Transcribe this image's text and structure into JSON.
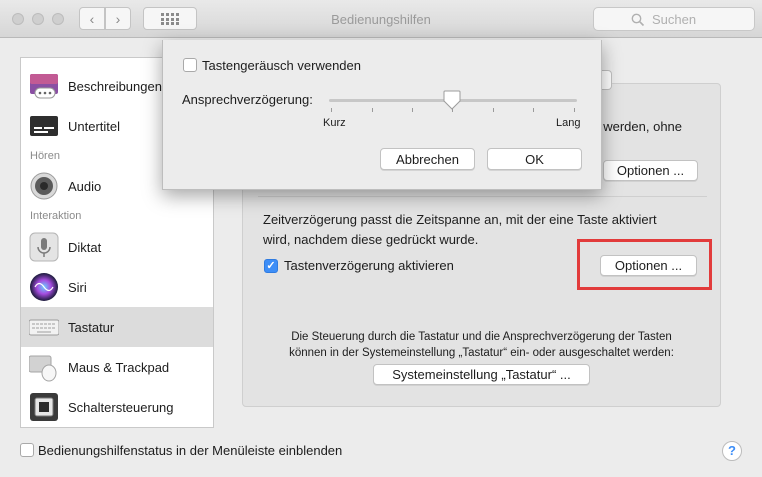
{
  "window": {
    "title": "Bedienungshilfen",
    "back_glyph": "‹",
    "forward_glyph": "›",
    "grid_glyph": "⋮⋮⋮",
    "search_placeholder": "Suchen"
  },
  "sidebar": {
    "items": [
      {
        "label": "Beschreibungen",
        "icon": "descriptions-icon"
      },
      {
        "label": "Untertitel",
        "icon": "captions-icon"
      },
      {
        "label": "Audio",
        "icon": "speaker-icon"
      },
      {
        "label": "Diktat",
        "icon": "microphone-icon"
      },
      {
        "label": "Siri",
        "icon": "siri-icon"
      },
      {
        "label": "Tastatur",
        "icon": "keyboard-icon"
      },
      {
        "label": "Maus & Trackpad",
        "icon": "mouse-trackpad-icon"
      },
      {
        "label": "Schaltersteuerung",
        "icon": "switch-control-icon"
      }
    ],
    "groups": {
      "hearing": "Hören",
      "interaction": "Interaktion"
    },
    "selected": "Tastatur"
  },
  "main": {
    "partial_text": "t werden, ohne",
    "options_top_label": "Optionen ...",
    "slow_keys_desc_line1": "Zeitverzögerung passt die Zeitspanne an, mit der eine Taste aktiviert",
    "slow_keys_desc_line2": "wird, nachdem diese gedrückt wurde.",
    "slow_keys_checkbox_label": "Tastenverzögerung aktivieren",
    "slow_keys_checkbox_checked": true,
    "options_slow_keys_label": "Optionen ...",
    "note_line1": "Die Steuerung durch die Tastatur und die Ansprechverzögerung der Tasten",
    "note_line2": "können in der Systemeinstellung „Tastatur“ ein- oder ausgeschaltet werden:",
    "keyboard_prefs_button": "Systemeinstellung „Tastatur“ ..."
  },
  "footer": {
    "menubar_checkbox_label": "Bedienungshilfenstatus in der Menüleiste einblenden",
    "menubar_checkbox_checked": false,
    "help_label": "?"
  },
  "dialog": {
    "sound_checkbox_label": "Tastengeräusch verwenden",
    "sound_checkbox_checked": false,
    "delay_label": "Ansprechverzögerung:",
    "slider_min_label": "Kurz",
    "slider_max_label": "Lang",
    "slider_value_fraction": 0.5,
    "cancel_label": "Abbrechen",
    "ok_label": "OK"
  },
  "colors": {
    "accent": "#3d8ef7",
    "highlight_box": "#e23b3b",
    "selected_row": "#dcdcdc"
  }
}
